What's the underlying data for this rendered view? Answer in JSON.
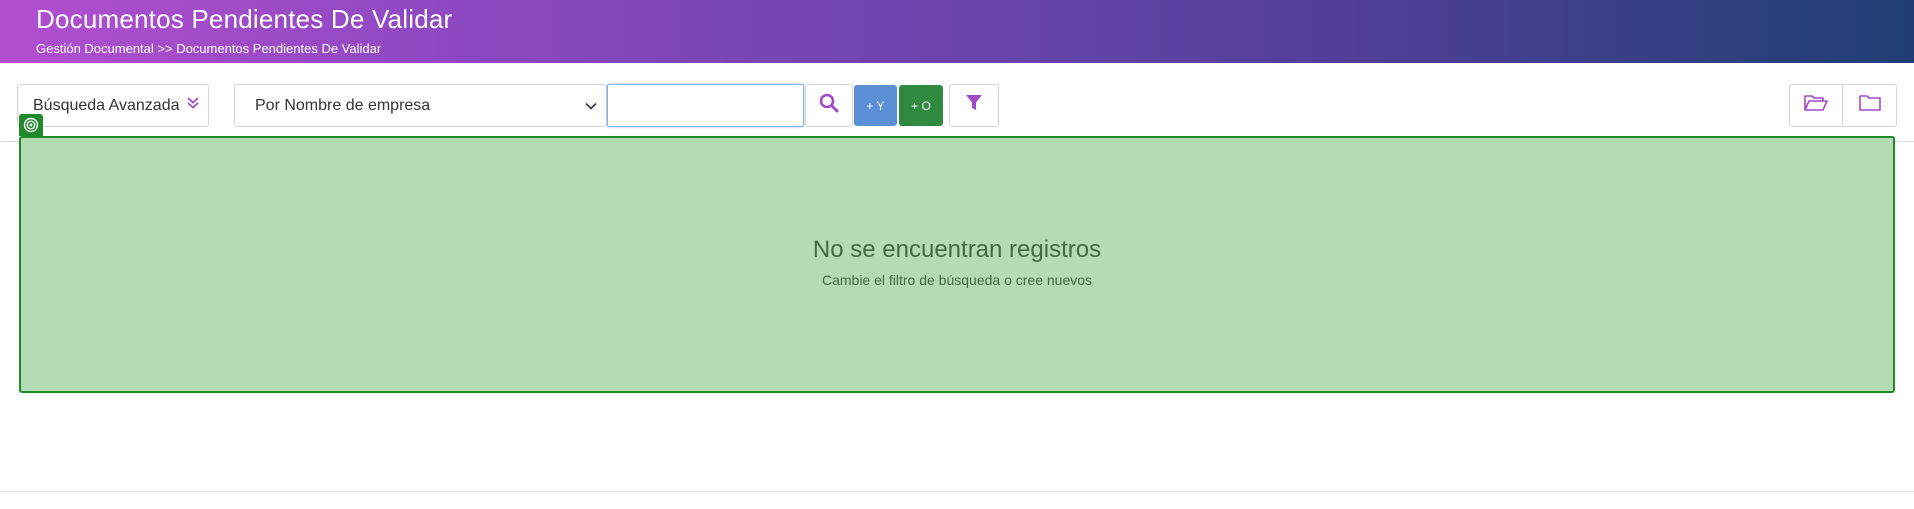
{
  "header": {
    "title": "Documentos Pendientes De Validar",
    "breadcrumb": "Gestión Documental >> Documentos Pendientes De Validar"
  },
  "toolbar": {
    "advanced_search_label": "Búsqueda Avanzada",
    "filter_select_value": "Por Nombre de empresa",
    "search_value": "",
    "and_label": "+ Y",
    "or_label": "+ O",
    "icons": {
      "advanced": "double-chevron-down-icon",
      "search": "search-icon",
      "filter": "filter-icon",
      "folder_open": "folder-open-icon",
      "folder": "folder-icon"
    }
  },
  "empty_state": {
    "message": "No se encuentran registros",
    "hint": "Cambie el filtro de búsqueda o cree nuevos"
  },
  "colors": {
    "accent": "#a349c9",
    "and_button": "#5b8fd6",
    "or_button": "#2f8a3f",
    "empty_bg": "#b4dcb4",
    "empty_border": "#1f8a2a"
  }
}
